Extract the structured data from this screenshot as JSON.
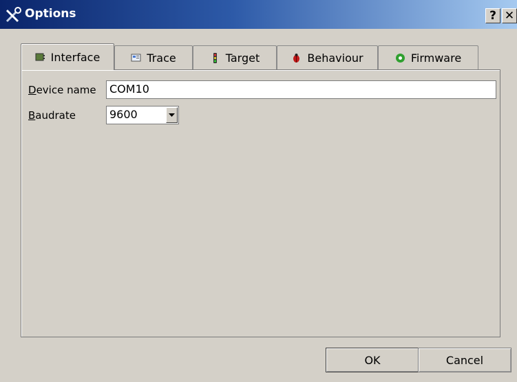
{
  "window": {
    "title": "Options",
    "title_icon": "tools-icon",
    "help_label": "?",
    "close_label": "✕"
  },
  "tabs": [
    {
      "label": "Interface",
      "icon": "interface-icon",
      "active": true
    },
    {
      "label": "Trace",
      "icon": "trace-icon",
      "active": false
    },
    {
      "label": "Target",
      "icon": "traffic-light-icon",
      "active": false
    },
    {
      "label": "Behaviour",
      "icon": "ladybug-icon",
      "active": false
    },
    {
      "label": "Firmware",
      "icon": "gear-green-icon",
      "active": false
    }
  ],
  "form": {
    "device_name_label_ul": "D",
    "device_name_label_rest": "evice name",
    "device_name_value": "COM10",
    "baudrate_label_ul": "B",
    "baudrate_label_rest": "audrate",
    "baudrate_value": "9600"
  },
  "buttons": {
    "ok": "OK",
    "cancel": "Cancel"
  }
}
